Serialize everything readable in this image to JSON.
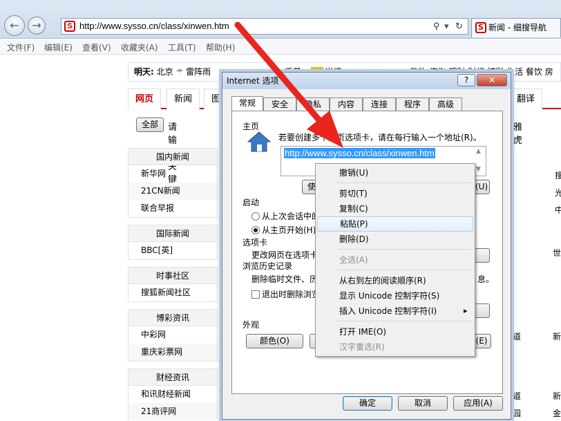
{
  "browser": {
    "url": "http://www.sysso.cn/class/xinwen.htm",
    "tab_title": "新闻 - 细搜导航",
    "menu": [
      "文件(F)",
      "编辑(E)",
      "查看(V)",
      "收藏夹(A)",
      "工具(T)",
      "帮助(H)"
    ]
  },
  "page": {
    "weather_label": "明天:",
    "weather_city": "北京",
    "weather_text": "雷阵雨",
    "weather_partial": "质量:",
    "weather_detail": "详细",
    "top_links": "购物 海淘 理财 财经 博彩 生活 餐饮 房",
    "search_tabs": [
      "网页",
      "新闻",
      "图"
    ],
    "search_right_tab": "翻译",
    "search_all": "全部",
    "search_placeholder": "请输入关键字",
    "search_right": "雅虎",
    "sections": [
      {
        "title": "国内新闻",
        "items": [
          "新华网",
          "21CN新闻",
          "联合早报"
        ],
        "right": [
          "搜",
          "光",
          "中"
        ]
      },
      {
        "title": "国际新闻",
        "items": [
          "BBC[英]"
        ],
        "right": [
          "世"
        ]
      },
      {
        "title": "时事社区",
        "items": [
          "搜狐新闻社区"
        ],
        "right": []
      },
      {
        "title": "博彩资讯",
        "items": [
          "中彩网",
          "重庆彩票网"
        ],
        "right": [
          "道",
          "新"
        ]
      },
      {
        "title": "财经资讯",
        "items": [
          "和讯财经新闻",
          "21商评网"
        ],
        "right": [
          "道",
          "新",
          "园",
          "金"
        ]
      }
    ]
  },
  "dialog": {
    "title": "Internet 选项",
    "help_btn": "?",
    "close_btn": "✕",
    "tabs": [
      "常规",
      "安全",
      "隐私",
      "内容",
      "连接",
      "程序",
      "高级"
    ],
    "home_group": "主页",
    "home_hint": "若要创建多个主页选项卡，请在每行输入一个地址(R)。",
    "home_url": "http://www.sysso.cn/class/xinwen.htm",
    "use_current_btn": "使用",
    "use_blank_btn": "(U)",
    "startup_group": "启动",
    "startup_opt1": "从上次会话中的",
    "startup_opt2": "从主页开始(H)",
    "tabs_group": "选项卡",
    "tabs_text": "更改网页在选项卡",
    "history_group": "浏览历史记录",
    "history_text": "删除临时文件、历",
    "history_text_right": "息。",
    "history_check": "退出时删除浏览",
    "appearance_group": "外观",
    "colors_btn": "颜色(O)",
    "accessibility_btn": "(E)",
    "ok_btn": "确定",
    "cancel_btn": "取消",
    "apply_btn": "应用(A)"
  },
  "context_menu": {
    "items": [
      {
        "label": "撤销(U)",
        "disabled": false
      },
      {
        "label": "剪切(T)",
        "disabled": false
      },
      {
        "label": "复制(C)",
        "disabled": false
      },
      {
        "label": "粘贴(P)",
        "disabled": false
      },
      {
        "label": "删除(D)",
        "disabled": false
      },
      {
        "label": "全选(A)",
        "disabled": true
      },
      {
        "label": "从右到左的阅读顺序(R)",
        "disabled": false
      },
      {
        "label": "显示 Unicode 控制字符(S)",
        "disabled": false
      },
      {
        "label": "插入 Unicode 控制字符(I)",
        "disabled": false
      },
      {
        "label": "打开 IME(O)",
        "disabled": false
      },
      {
        "label": "汉字重选(R)",
        "disabled": true
      }
    ],
    "submenu_arrow": "▸"
  },
  "colors": {
    "arrow": "#e8261f",
    "selection": "#3399ff",
    "brand_red": "#cc0000"
  }
}
